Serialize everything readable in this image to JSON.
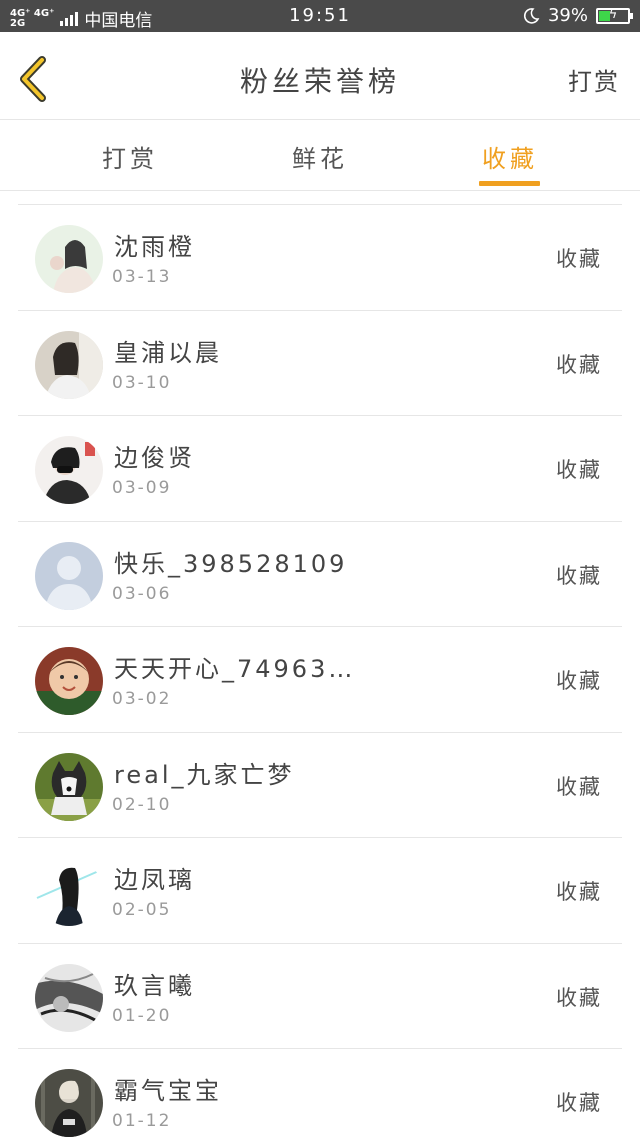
{
  "status_bar": {
    "network_top": "4G⁺ 4G⁺",
    "network_bottom": "2G",
    "carrier": "中国电信",
    "time": "19:51",
    "moon_icon": "moon-icon",
    "battery_percent": "39%",
    "battery_level": 0.39,
    "battery_color": "#3ed64a"
  },
  "header": {
    "back_icon": "chevron-left-icon",
    "title": "粉丝荣誉榜",
    "action_label": "打赏"
  },
  "tabs": [
    {
      "label": "打赏",
      "active": false
    },
    {
      "label": "鲜花",
      "active": false
    },
    {
      "label": "收藏",
      "active": true
    }
  ],
  "accent_color": "#f0a020",
  "list": [
    {
      "name": "沈雨橙",
      "date": "03-13",
      "action": "收藏"
    },
    {
      "name": "皇浦以晨",
      "date": "03-10",
      "action": "收藏"
    },
    {
      "name": "边俊贤",
      "date": "03-09",
      "action": "收藏"
    },
    {
      "name": "快乐_398528109",
      "date": "03-06",
      "action": "收藏"
    },
    {
      "name": "天天开心_74963…",
      "date": "03-02",
      "action": "收藏"
    },
    {
      "name": "real_九家亡梦",
      "date": "02-10",
      "action": "收藏"
    },
    {
      "name": "边凤璃",
      "date": "02-05",
      "action": "收藏"
    },
    {
      "name": "玖言曦",
      "date": "01-20",
      "action": "收藏"
    },
    {
      "name": "霸气宝宝",
      "date": "01-12",
      "action": "收藏"
    }
  ]
}
